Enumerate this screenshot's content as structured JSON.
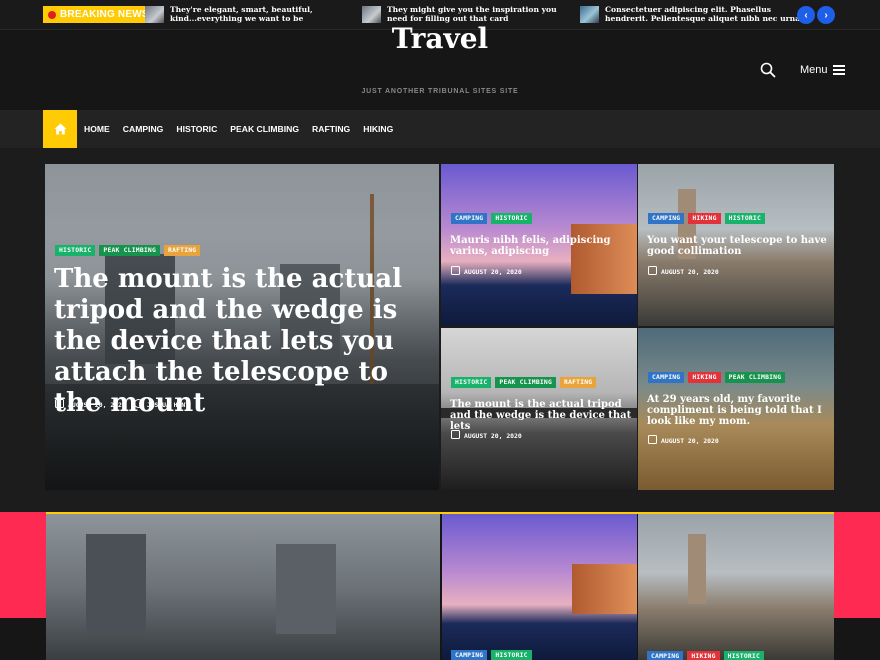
{
  "topbar": {
    "breaking_label": "BREAKING NEWS",
    "ticker": [
      "They're elegant, smart, beautiful, kind...everything we want to be",
      "They might give you the inspiration you need for filling out that card",
      "Consectetuer adipiscing elit. Phasellus hendrerit. Pellentesque aliquet nibh nec urna."
    ],
    "prev_icon": "‹",
    "next_icon": "›"
  },
  "header": {
    "site_title": "Travel",
    "tagline": "JUST ANOTHER TRIBUNAL SITES SITE",
    "menu_label": "Menu"
  },
  "nav": {
    "items": [
      "HOME",
      "CAMPING",
      "HISTORIC",
      "PEAK CLIMBING",
      "RAFTING",
      "HIKING"
    ]
  },
  "colors": {
    "accent": "#ffcb05",
    "historic": "#19b26b",
    "peak_climbing": "#16934c",
    "rafting": "#e8a33a",
    "camping": "#2f74c7",
    "hiking": "#e2333a",
    "pink_band": "#ff2a52",
    "arrow_blue": "#1e5ee8"
  },
  "featured": {
    "main": {
      "cats": [
        "HISTORIC",
        "PEAK CLIMBING",
        "RAFTING"
      ],
      "title": "The mount is the actual tripod and the wedge is the device that lets you attach the telescope to the mount",
      "date": "AUGUST 20, 2020",
      "author": "JOSHUA HUNT"
    },
    "card1": {
      "cats": [
        "CAMPING",
        "HISTORIC"
      ],
      "title": "Mauris nibh felis, adipiscing varius, adipiscing",
      "date": "AUGUST 20, 2020"
    },
    "card2": {
      "cats": [
        "CAMPING",
        "HIKING",
        "HISTORIC"
      ],
      "title": "You want your telescope to have good collimation",
      "date": "AUGUST 20, 2020"
    },
    "card3": {
      "cats": [
        "HISTORIC",
        "PEAK CLIMBING",
        "RAFTING"
      ],
      "title": "The mount is the actual tripod and the wedge is the device that lets",
      "date": "AUGUST 20, 2020"
    },
    "card4": {
      "cats": [
        "CAMPING",
        "HIKING",
        "PEAK CLIMBING"
      ],
      "title": "At 29 years old, my favorite compliment is being told that I look like my mom.",
      "date": "AUGUST 20, 2020"
    }
  },
  "second_row": {
    "card_mid_cats": [
      "CAMPING",
      "HISTORIC"
    ],
    "card_right_cats": [
      "CAMPING",
      "HIKING",
      "HISTORIC"
    ]
  }
}
